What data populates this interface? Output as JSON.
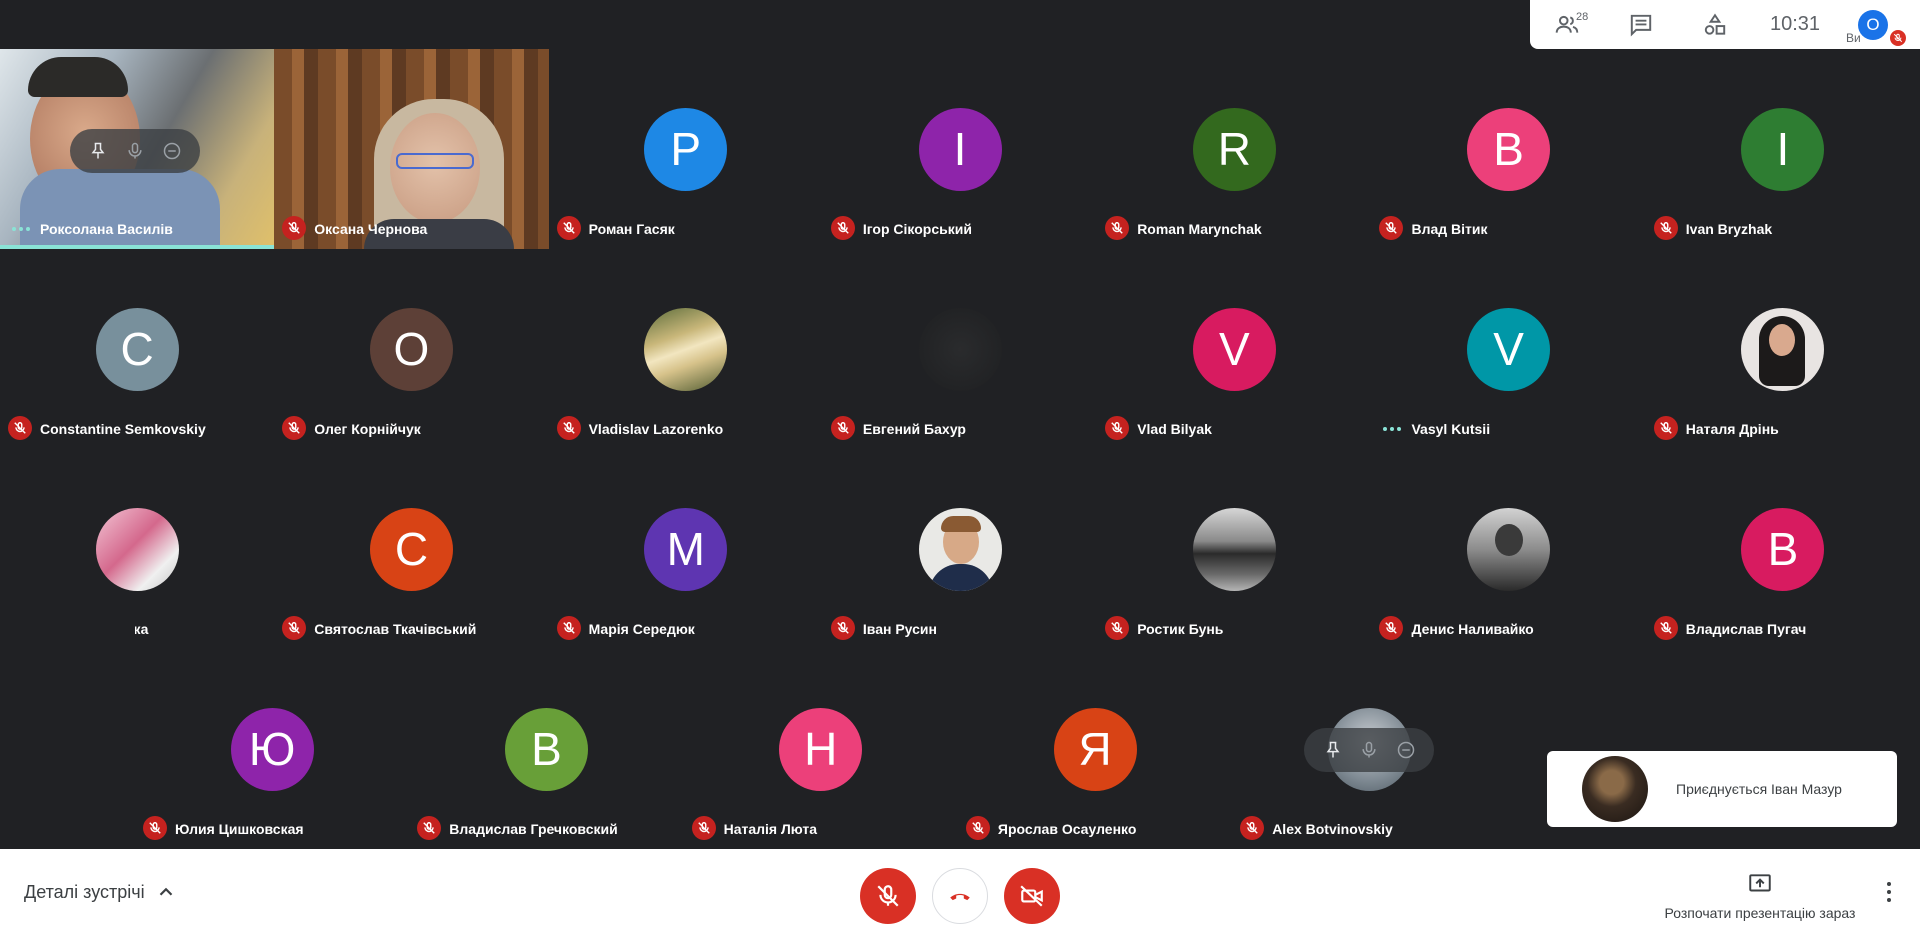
{
  "topbar": {
    "people_count": "28",
    "clock": "10:31",
    "self_initial": "O",
    "self_label": "Ви"
  },
  "rows": [
    [
      {
        "name": "Роксолана Василів",
        "kind": "video",
        "speaking": true
      },
      {
        "name": "Оксана Чернова",
        "kind": "video",
        "muted": true
      },
      {
        "name": "Роман Гасяк",
        "initial": "Р",
        "color": "#1e88e5",
        "muted": true
      },
      {
        "name": "Ігор Сікорський",
        "initial": "І",
        "color": "#8e24aa",
        "muted": true
      },
      {
        "name": "Roman Marynchak",
        "initial": "R",
        "color": "#33691e",
        "muted": true
      },
      {
        "name": "Влад Вітик",
        "initial": "В",
        "color": "#ec407a",
        "muted": true
      },
      {
        "name": "Ivan Bryzhak",
        "initial": "I",
        "color": "#2e7d32",
        "muted": true
      }
    ],
    [
      {
        "name": "Constantine Semkovskiy",
        "initial": "C",
        "color": "#78909c",
        "muted": true
      },
      {
        "name": "Олег Корнійчук",
        "initial": "О",
        "color": "#5d4037",
        "muted": true
      },
      {
        "name": "Vladislav Lazorenko",
        "photo": "landscape",
        "muted": true
      },
      {
        "name": "Евгений Бахур",
        "photo": "dark",
        "muted": true
      },
      {
        "name": "Vlad Bilyak",
        "initial": "V",
        "color": "#d81b60",
        "muted": true
      },
      {
        "name": "Vasyl Kutsii",
        "initial": "V",
        "color": "#0097a7",
        "speaking": true
      },
      {
        "name": "Наталя Дрінь",
        "photo": "woman",
        "muted": true
      }
    ],
    [
      {
        "name": "Николай Цюпка",
        "photo": "pink",
        "muted": true
      },
      {
        "name": "Святослав Ткачівський",
        "initial": "С",
        "color": "#d84315",
        "muted": true
      },
      {
        "name": "Марія Середюк",
        "initial": "М",
        "color": "#5e35b1",
        "muted": true
      },
      {
        "name": "Іван Русин",
        "photo": "man",
        "muted": true
      },
      {
        "name": "Ростик Бунь",
        "photo": "car",
        "muted": true
      },
      {
        "name": "Денис Наливайко",
        "photo": "bw",
        "muted": true
      },
      {
        "name": "Владислав Пугач",
        "initial": "В",
        "color": "#d81b60",
        "muted": true
      }
    ],
    [
      {
        "name": "Юлия Цишковская",
        "initial": "Ю",
        "color": "#8e24aa",
        "muted": true
      },
      {
        "name": "Владислав Гречковский",
        "initial": "В",
        "color": "#689f38",
        "muted": true
      },
      {
        "name": "Наталія Люта",
        "initial": "Н",
        "color": "#ec407a",
        "muted": true
      },
      {
        "name": "Ярослав Осауленко",
        "initial": "Я",
        "color": "#d84315",
        "muted": true
      },
      {
        "name": "Alex Botvinovskiy",
        "photo": "hand",
        "muted": true,
        "hover": true
      }
    ]
  ],
  "toast": {
    "text": "Приєднується Іван Мазур"
  },
  "bottombar": {
    "details_label": "Деталі зустрічі",
    "present_label": "Розпочати презентацію зараз"
  }
}
